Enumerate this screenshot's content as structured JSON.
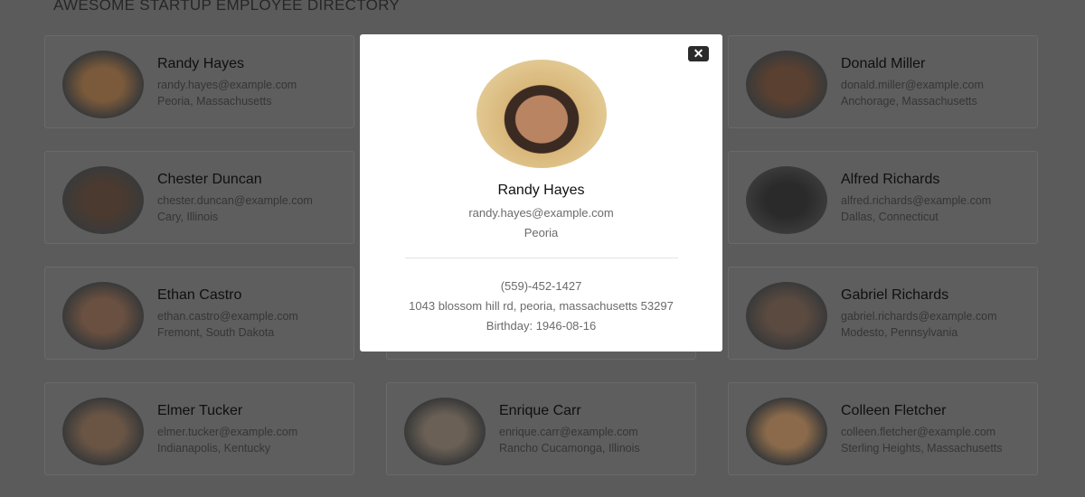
{
  "page_title": "AWESOME STARTUP EMPLOYEE DIRECTORY",
  "employees": [
    {
      "name": "Randy Hayes",
      "email": "randy.hayes@example.com",
      "location": "Peoria, Massachusetts"
    },
    {
      "name": "Donald Miller",
      "email": "donald.miller@example.com",
      "location": "Anchorage, Massachusetts"
    },
    {
      "name": "Chester Duncan",
      "email": "chester.duncan@example.com",
      "location": "Cary, Illinois"
    },
    {
      "name": "Alfred Richards",
      "email": "alfred.richards@example.com",
      "location": "Dallas, Connecticut"
    },
    {
      "name": "Ethan Castro",
      "email": "ethan.castro@example.com",
      "location": "Fremont, South Dakota"
    },
    {
      "name": "Gabriel Richards",
      "email": "gabriel.richards@example.com",
      "location": "Modesto, Pennsylvania"
    },
    {
      "name": "Elmer Tucker",
      "email": "elmer.tucker@example.com",
      "location": "Indianapolis, Kentucky"
    },
    {
      "name": "Enrique Carr",
      "email": "enrique.carr@example.com",
      "location": "Rancho Cucamonga, Illinois"
    },
    {
      "name": "Colleen Fletcher",
      "email": "colleen.fletcher@example.com",
      "location": "Sterling Heights, Massachusetts"
    }
  ],
  "modal": {
    "close_label": "✕",
    "name": "Randy Hayes",
    "email": "randy.hayes@example.com",
    "city": "Peoria",
    "phone": "(559)-452-1427",
    "address": "1043 blossom hill rd, peoria, massachusetts 53297",
    "birthday": "Birthday: 1946-08-16"
  }
}
